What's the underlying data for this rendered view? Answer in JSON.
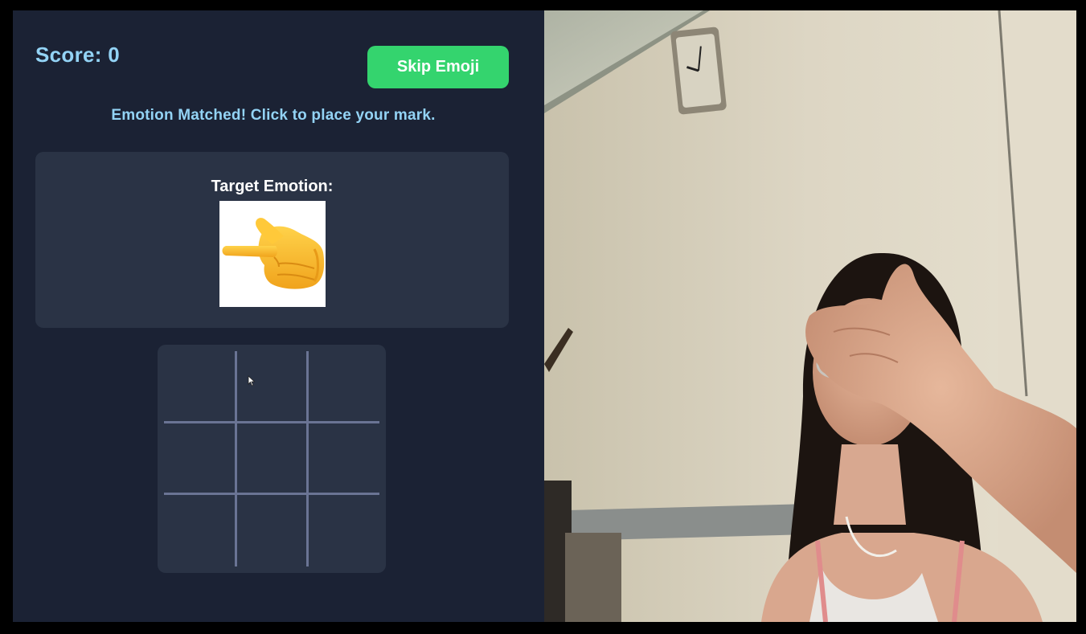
{
  "score": {
    "label": "Score: 0"
  },
  "skip_button": {
    "label": "Skip Emoji"
  },
  "status_message": "Emotion Matched! Click to place your mark.",
  "target": {
    "label": "Target Emotion:",
    "emoji_icon": "backhand-index-pointing-left-icon"
  },
  "board": {
    "cells": [
      "",
      "",
      "",
      "",
      "",
      "",
      "",
      "",
      ""
    ]
  },
  "webcam": {
    "icon": "webcam-feed-person"
  },
  "colors": {
    "panel_bg": "#1b2234",
    "card_bg": "#2a3345",
    "accent_text": "#93d3f5",
    "skip_button": "#34d46e",
    "grid_line": "#6a7494"
  }
}
